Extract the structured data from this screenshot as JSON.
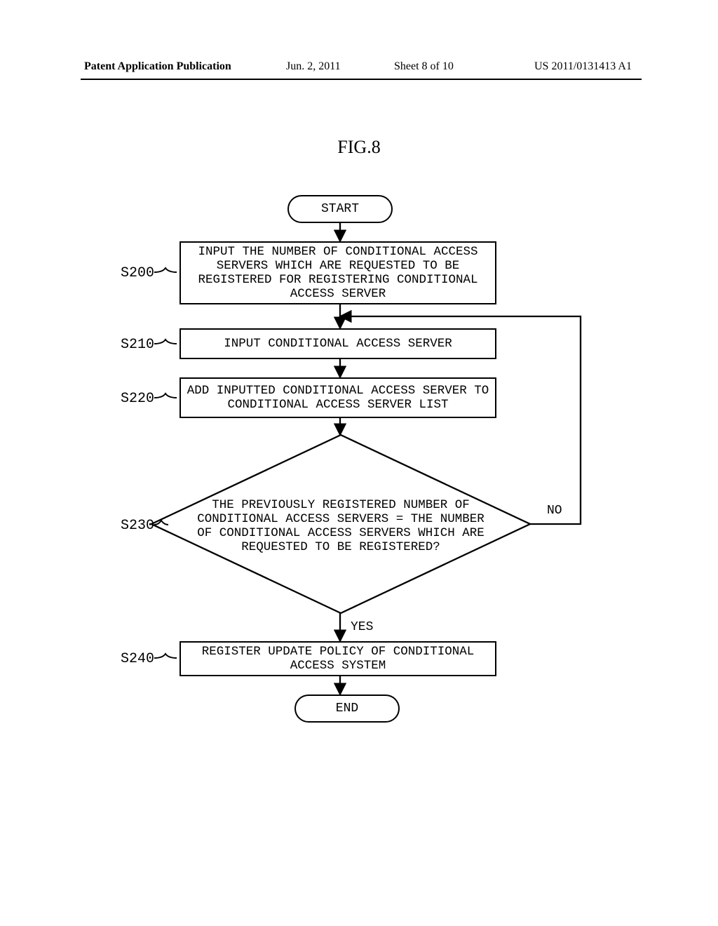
{
  "header": {
    "left": "Patent Application Publication",
    "date": "Jun. 2, 2011",
    "sheet": "Sheet 8 of 10",
    "pubno": "US 2011/0131413 A1"
  },
  "figure_label": "FIG.8",
  "terminals": {
    "start": "START",
    "end": "END"
  },
  "steps": {
    "s200": {
      "tag": "S200",
      "text": "INPUT THE NUMBER OF CONDITIONAL ACCESS SERVERS WHICH ARE REQUESTED TO BE REGISTERED FOR REGISTERING CONDITIONAL ACCESS SERVER"
    },
    "s210": {
      "tag": "S210",
      "text": "INPUT CONDITIONAL ACCESS SERVER"
    },
    "s220": {
      "tag": "S220",
      "text": "ADD INPUTTED CONDITIONAL ACCESS SERVER TO CONDITIONAL ACCESS SERVER LIST"
    },
    "s230": {
      "tag": "S230",
      "text": "THE PREVIOUSLY REGISTERED NUMBER OF CONDITIONAL ACCESS SERVERS = THE NUMBER OF CONDITIONAL ACCESS SERVERS WHICH ARE REQUESTED TO BE REGISTERED?"
    },
    "s240": {
      "tag": "S240",
      "text": "REGISTER UPDATE POLICY OF CONDITIONAL ACCESS SYSTEM"
    }
  },
  "edges": {
    "yes": "YES",
    "no": "NO"
  },
  "chart_data": {
    "type": "flowchart",
    "title": "FIG.8",
    "nodes": [
      {
        "id": "start",
        "kind": "terminator",
        "label": "START"
      },
      {
        "id": "S200",
        "kind": "process",
        "label": "INPUT THE NUMBER OF CONDITIONAL ACCESS SERVERS WHICH ARE REQUESTED TO BE REGISTERED FOR REGISTERING CONDITIONAL ACCESS SERVER"
      },
      {
        "id": "S210",
        "kind": "process",
        "label": "INPUT CONDITIONAL ACCESS SERVER"
      },
      {
        "id": "S220",
        "kind": "process",
        "label": "ADD INPUTTED CONDITIONAL ACCESS SERVER TO CONDITIONAL ACCESS SERVER LIST"
      },
      {
        "id": "S230",
        "kind": "decision",
        "label": "THE PREVIOUSLY REGISTERED NUMBER OF CONDITIONAL ACCESS SERVERS = THE NUMBER OF CONDITIONAL ACCESS SERVERS WHICH ARE REQUESTED TO BE REGISTERED?"
      },
      {
        "id": "S240",
        "kind": "process",
        "label": "REGISTER UPDATE POLICY OF CONDITIONAL ACCESS SYSTEM"
      },
      {
        "id": "end",
        "kind": "terminator",
        "label": "END"
      }
    ],
    "edges": [
      {
        "from": "start",
        "to": "S200"
      },
      {
        "from": "S200",
        "to": "S210"
      },
      {
        "from": "S210",
        "to": "S220"
      },
      {
        "from": "S220",
        "to": "S230"
      },
      {
        "from": "S230",
        "to": "S240",
        "label": "YES"
      },
      {
        "from": "S230",
        "to": "S210",
        "label": "NO"
      },
      {
        "from": "S240",
        "to": "end"
      }
    ]
  }
}
